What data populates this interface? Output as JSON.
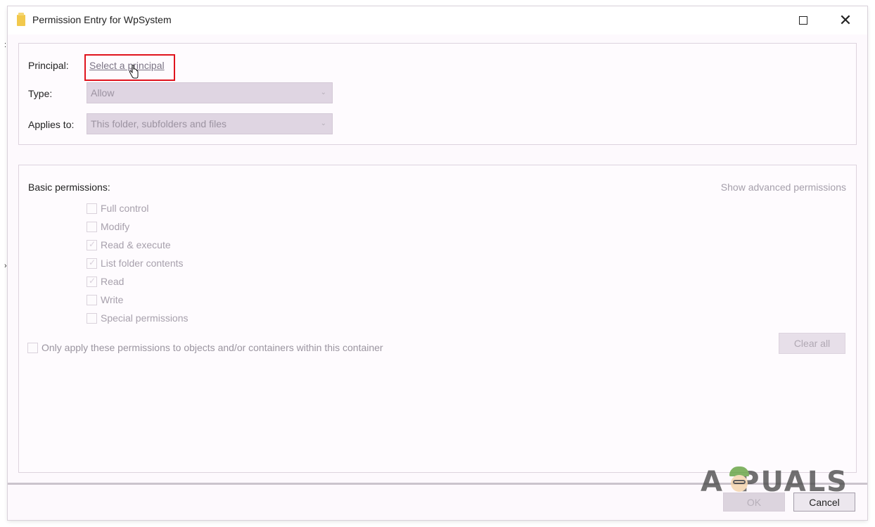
{
  "window": {
    "title": "Permission Entry for WpSystem",
    "title_icon": "folder-icon",
    "maximize_icon": "maximize-icon",
    "close_icon": "close-icon"
  },
  "principal": {
    "label": "Principal:",
    "link_text": "Select a principal"
  },
  "type": {
    "label": "Type:",
    "selected": "Allow"
  },
  "applies_to": {
    "label": "Applies to:",
    "selected": "This folder, subfolders and files"
  },
  "basic_permissions": {
    "label": "Basic permissions:",
    "show_advanced": "Show advanced permissions",
    "items": [
      {
        "label": "Full control",
        "checked": false
      },
      {
        "label": "Modify",
        "checked": false
      },
      {
        "label": "Read & execute",
        "checked": true
      },
      {
        "label": "List folder contents",
        "checked": true
      },
      {
        "label": "Read",
        "checked": true
      },
      {
        "label": "Write",
        "checked": false
      },
      {
        "label": "Special permissions",
        "checked": false
      }
    ],
    "only_apply": "Only apply these permissions to objects and/or containers within this container",
    "clear_all": "Clear all"
  },
  "footer": {
    "ok": "OK",
    "cancel": "Cancel"
  },
  "watermark": {
    "text_left": "A",
    "text_right": "PUALS"
  },
  "colors": {
    "highlight": "#e0141e",
    "disabled_text": "#a7a0ac",
    "link": "#7b7485"
  }
}
